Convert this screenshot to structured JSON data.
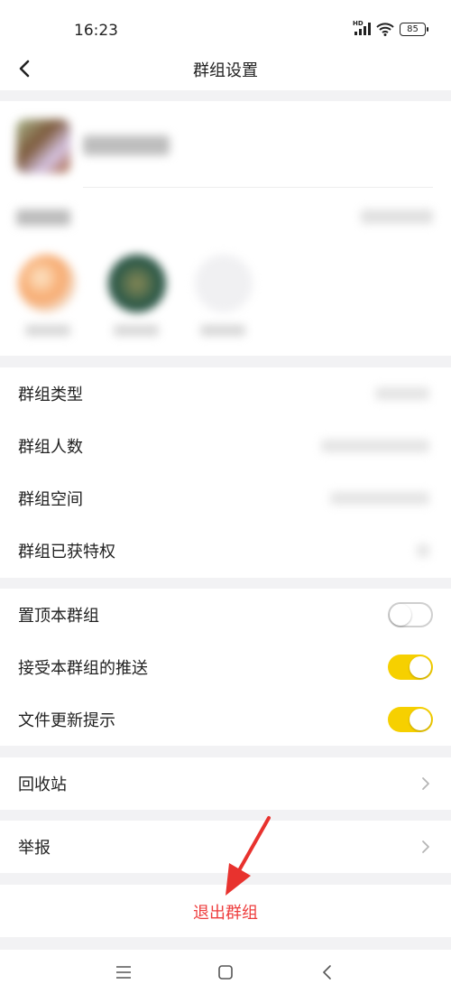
{
  "status_bar": {
    "time": "16:23",
    "network_label": "HD",
    "battery": "85"
  },
  "header": {
    "title": "群组设置",
    "back_icon": "back-arrow-icon"
  },
  "settings_group_1": [
    {
      "label": "群组类型",
      "has_chevron": false
    },
    {
      "label": "群组人数",
      "has_chevron": true
    },
    {
      "label": "群组空间",
      "has_chevron": true
    },
    {
      "label": "群组已获特权",
      "has_chevron": true
    }
  ],
  "settings_group_2": [
    {
      "label": "置顶本群组",
      "toggle": "off"
    },
    {
      "label": "接受本群组的推送",
      "toggle": "on"
    },
    {
      "label": "文件更新提示",
      "toggle": "on"
    }
  ],
  "recycle_bin": {
    "label": "回收站"
  },
  "report": {
    "label": "举报"
  },
  "exit_group": {
    "label": "退出群组",
    "color": "#ee3d3d"
  },
  "colors": {
    "toggle_on": "#f6d000",
    "accent_red": "#ee3d3d"
  }
}
